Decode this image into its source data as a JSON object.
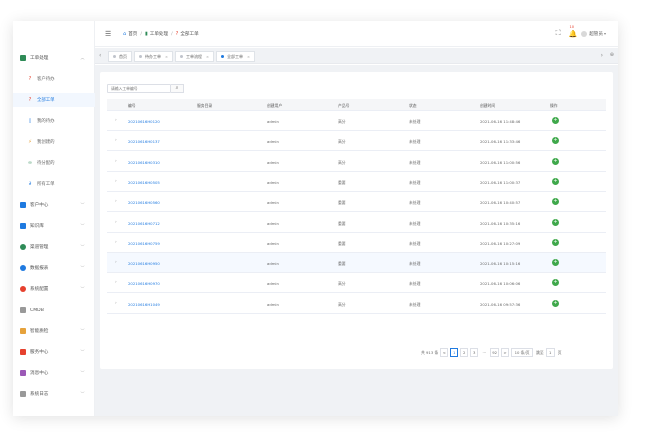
{
  "sidebar": {
    "items": [
      {
        "label": "工单处理",
        "icon": "ticket-icon",
        "color": "#2e8b57",
        "expanded": true
      },
      {
        "label": "客户中心",
        "icon": "user-icon",
        "color": "#1f7ae0"
      },
      {
        "label": "知识库",
        "icon": "book-icon",
        "color": "#1f7ae0"
      },
      {
        "label": "渠道管理",
        "icon": "globe-icon",
        "color": "#2e8b57"
      },
      {
        "label": "数据报表",
        "icon": "chart-icon",
        "color": "#1f7ae0"
      },
      {
        "label": "系统配置",
        "icon": "gear-icon",
        "color": "#e6412e"
      },
      {
        "label": "CMDB",
        "icon": "database-icon",
        "color": "#999999"
      },
      {
        "label": "智能质检",
        "icon": "bar-chart-icon",
        "color": "#e6a23c"
      },
      {
        "label": "服务中心",
        "icon": "monitor-icon",
        "color": "#e6412e"
      },
      {
        "label": "消息中心",
        "icon": "message-icon",
        "color": "#9b59b6"
      },
      {
        "label": "系统日志",
        "icon": "log-icon",
        "color": "#999999"
      }
    ],
    "subitems": [
      {
        "label": "客户待办",
        "icon": "question-icon"
      },
      {
        "label": "全部工单",
        "icon": "question-icon",
        "active": true
      },
      {
        "label": "我的待办",
        "icon": "doc-icon"
      },
      {
        "label": "我创建的",
        "icon": "lightning-icon"
      },
      {
        "label": "待分配的",
        "icon": "people-icon"
      },
      {
        "label": "所有工单",
        "icon": "link-icon"
      }
    ]
  },
  "header": {
    "breadcrumb": [
      "首页",
      "工单处理",
      "全部工单"
    ],
    "notification_count": "10",
    "user_name": "超管员"
  },
  "tabs": [
    {
      "label": "首页"
    },
    {
      "label": "待办工单"
    },
    {
      "label": "工单流程"
    },
    {
      "label": "全部工单",
      "active": true
    }
  ],
  "search": {
    "placeholder": "请输入工单编号"
  },
  "table": {
    "columns": [
      "编号",
      "服务目录",
      "创建用户",
      "产品号",
      "状态",
      "创建时间",
      "操作"
    ],
    "rows": [
      {
        "id": "20210616H0120",
        "creator": "admin",
        "product": "高分",
        "status": "未处理",
        "created": "2021-06-16 11:48:46"
      },
      {
        "id": "20210616H0137",
        "creator": "admin",
        "product": "高分",
        "status": "未处理",
        "created": "2021-06-16 11:33:46"
      },
      {
        "id": "20210616H0310",
        "creator": "admin",
        "product": "高分",
        "status": "未处理",
        "created": "2021-06-16 11:00:56"
      },
      {
        "id": "20210616H0505",
        "creator": "admin",
        "product": "重要",
        "status": "未处理",
        "created": "2021-06-16 11:00:37"
      },
      {
        "id": "20210616H0560",
        "creator": "admin",
        "product": "重要",
        "status": "未处理",
        "created": "2021-06-16 10:40:57"
      },
      {
        "id": "20210616H0712",
        "creator": "admin",
        "product": "重要",
        "status": "未处理",
        "created": "2021-06-16 10:35:16"
      },
      {
        "id": "20210616H0759",
        "creator": "admin",
        "product": "重要",
        "status": "未处理",
        "created": "2021-06-16 10:27:09"
      },
      {
        "id": "20210616H0950",
        "creator": "admin",
        "product": "重要",
        "status": "未处理",
        "created": "2021-06-16 10:15:16"
      },
      {
        "id": "20210616H0970",
        "creator": "admin",
        "product": "高分",
        "status": "未处理",
        "created": "2021-06-16 10:06:06"
      },
      {
        "id": "20210616H1049",
        "creator": "admin",
        "product": "高分",
        "status": "未处理",
        "created": "2021-06-16 09:57:36"
      }
    ]
  },
  "pagination": {
    "total": "共 913 条",
    "prev": "<",
    "pages": [
      "1",
      "2",
      "3"
    ],
    "ellipsis": "...",
    "last": "92",
    "next": ">",
    "page_size": "10 条/页",
    "goto": "跳至",
    "goto_value": "1",
    "page_suffix": "页"
  }
}
